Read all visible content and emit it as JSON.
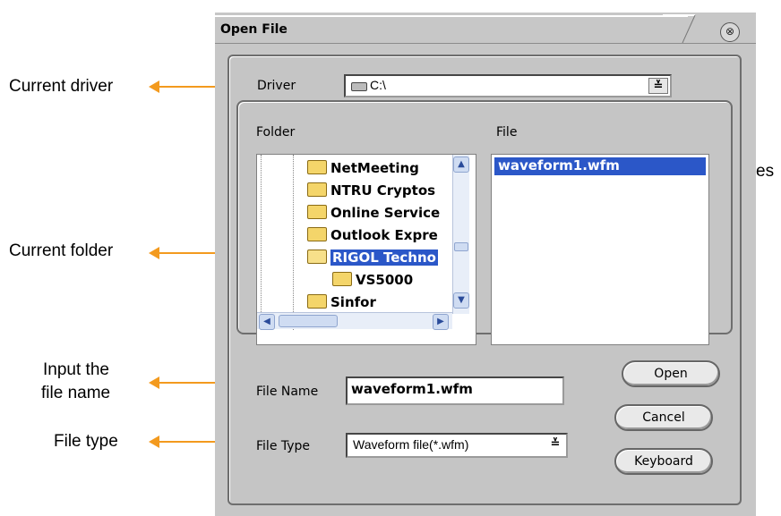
{
  "callouts": {
    "current_driver": "Current driver",
    "current_folder": "Current folder",
    "input_file_name_line1": "Input the",
    "input_file_name_line2": "file name",
    "file_type": "File type",
    "files": "Files"
  },
  "dialog": {
    "title": "Open File",
    "close_glyph": "⊗",
    "driver_label": "Driver",
    "driver_value": "C:\\",
    "folder_label": "Folder",
    "file_label": "File",
    "folders": [
      "NetMeeting",
      "NTRU Cryptos",
      "Online Service",
      "Outlook Expre",
      "RIGOL Techno",
      "VS5000",
      "Sinfor"
    ],
    "selected_folder": "RIGOL Techno",
    "files": [
      "waveform1.wfm"
    ],
    "file_name_label": "File Name",
    "file_name_value": "waveform1.wfm",
    "file_type_label": "File Type",
    "file_type_value": "Waveform file(*.wfm)",
    "buttons": {
      "open": "Open",
      "cancel": "Cancel",
      "keyboard": "Keyboard"
    },
    "dropdown_glyph": "≚"
  },
  "colors": {
    "callout_arrow": "#f39a1e",
    "selection": "#2b57c8",
    "dialog_bg": "#c7c7c7"
  }
}
